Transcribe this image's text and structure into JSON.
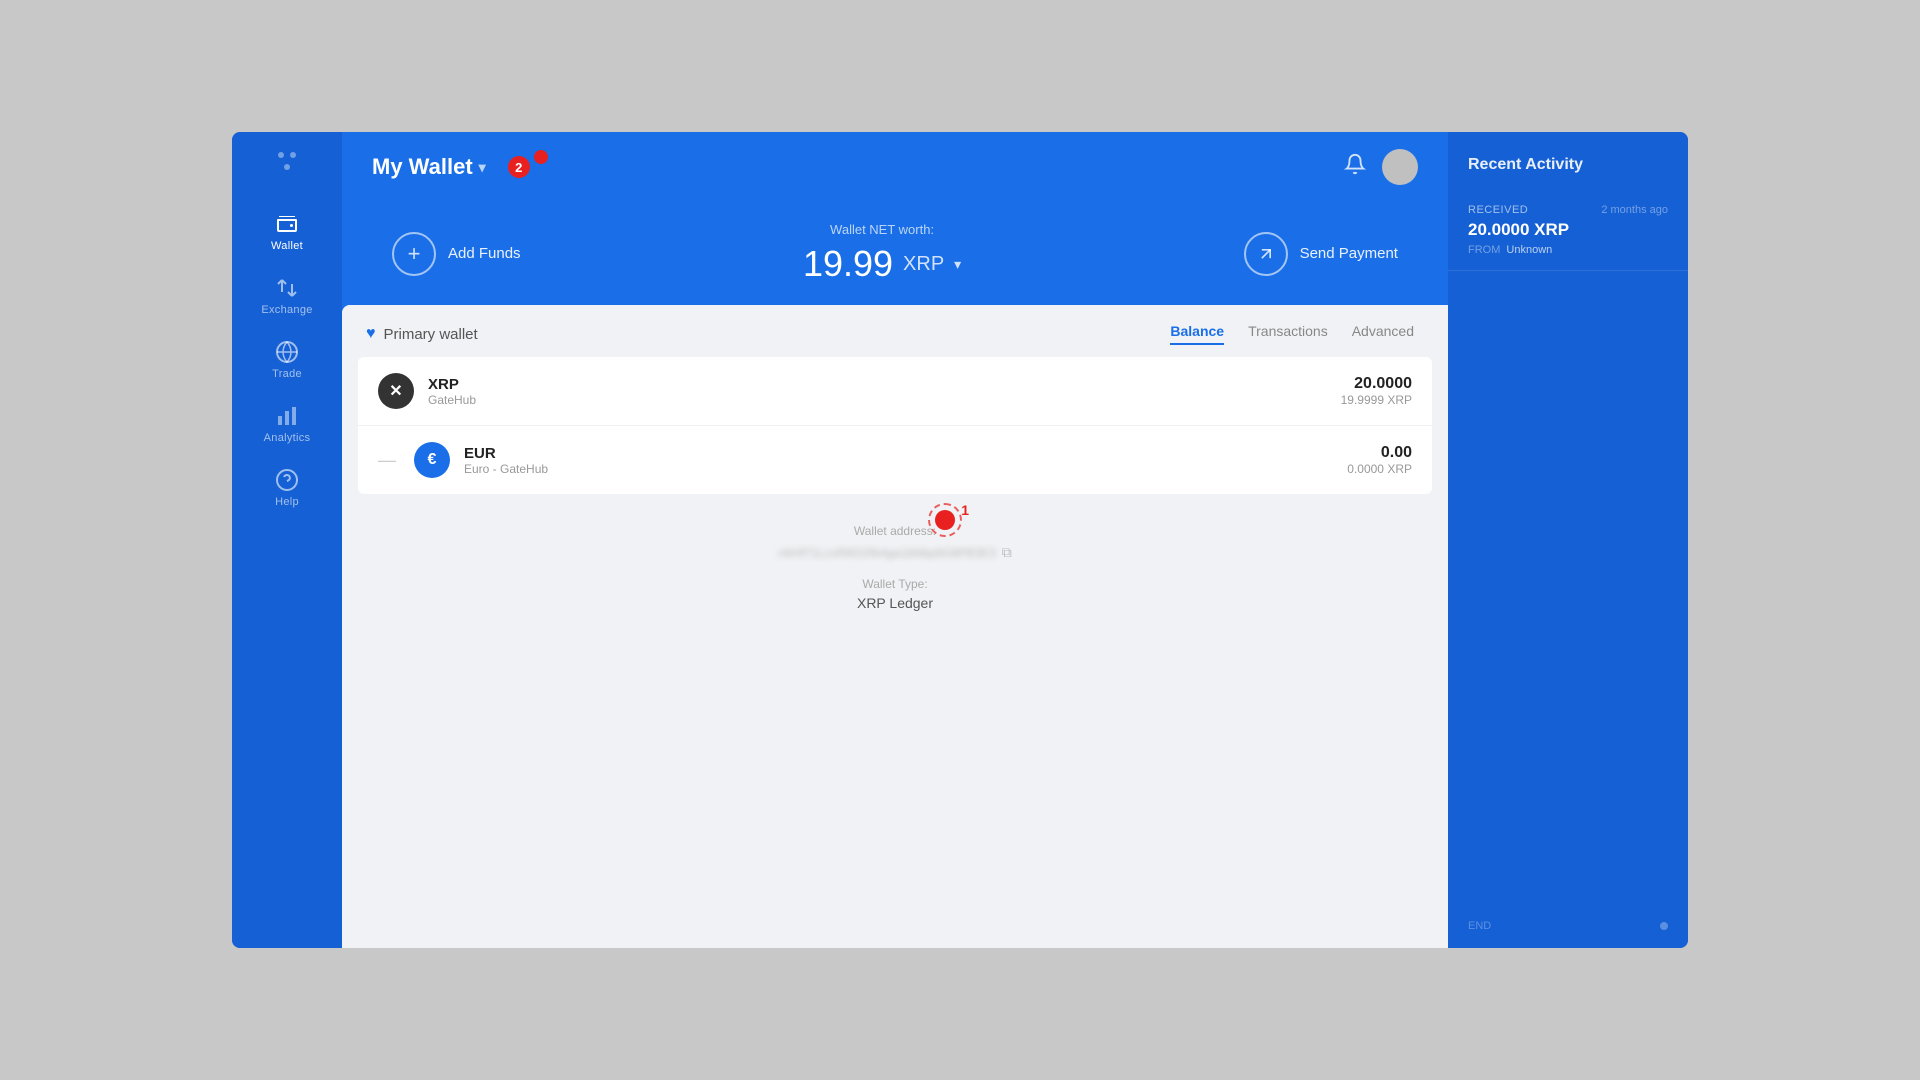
{
  "app": {
    "title": "My Wallet",
    "chevron": "▾",
    "badge_count": "2"
  },
  "sidebar": {
    "items": [
      {
        "id": "wallet",
        "label": "Wallet",
        "icon": "wallet",
        "active": true
      },
      {
        "id": "exchange",
        "label": "Exchange",
        "icon": "exchange"
      },
      {
        "id": "trade",
        "label": "Trade",
        "icon": "trade"
      },
      {
        "id": "analytics",
        "label": "Analytics",
        "icon": "analytics"
      },
      {
        "id": "help",
        "label": "Help",
        "icon": "help"
      }
    ]
  },
  "hero": {
    "add_funds_label": "Add Funds",
    "net_worth_label": "Wallet NET worth:",
    "amount": "19.99",
    "currency": "XRP",
    "send_payment_label": "Send Payment"
  },
  "wallet": {
    "name": "Primary wallet",
    "tabs": [
      {
        "id": "balance",
        "label": "Balance",
        "active": true
      },
      {
        "id": "transactions",
        "label": "Transactions",
        "active": false
      },
      {
        "id": "advanced",
        "label": "Advanced",
        "active": false
      }
    ],
    "balances": [
      {
        "symbol": "XRP",
        "icon": "✕",
        "provider": "GateHub",
        "amount": "20.0000",
        "xrp_value": "19.9999 XRP"
      },
      {
        "symbol": "EUR",
        "icon": "€",
        "provider": "Euro - GateHub",
        "amount": "0.00",
        "xrp_value": "0.0000 XRP"
      }
    ],
    "address_label": "Wallet address:",
    "address_value": "r4rHf71LcvR601Rk4ga1bNbp6G8PB3E3",
    "type_label": "Wallet Type:",
    "type_value": "XRP Ledger"
  },
  "recent_activity": {
    "title": "Recent Activity",
    "items": [
      {
        "type": "RECEIVED",
        "time": "2 months ago",
        "amount": "20.0000 XRP",
        "from_label": "FROM",
        "from_value": "Unknown"
      }
    ],
    "end_label": "END"
  },
  "annotations": {
    "dot1_number": "1",
    "dot2_number": "2"
  }
}
